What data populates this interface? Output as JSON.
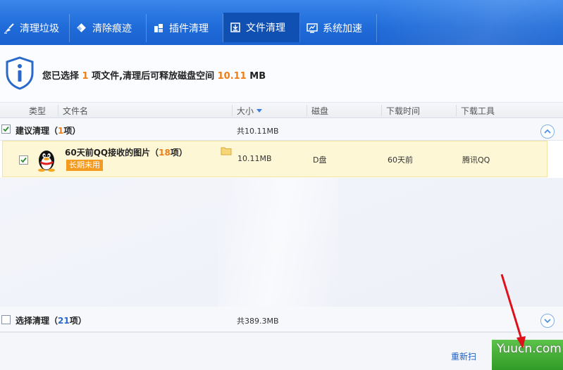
{
  "tabs": [
    {
      "label": "清理垃圾",
      "icon": "broom-icon"
    },
    {
      "label": "清除痕迹",
      "icon": "eraser-icon"
    },
    {
      "label": "插件清理",
      "icon": "plugin-icon"
    },
    {
      "label": "文件清理",
      "icon": "download-box-icon",
      "active": true
    },
    {
      "label": "系统加速",
      "icon": "monitor-icon"
    }
  ],
  "summary": {
    "prefix": "您已选择",
    "count": "1",
    "middle": "项文件,清理后可释放磁盘空间",
    "size": "10.11",
    "unit": "MB"
  },
  "columns": {
    "type": "类型",
    "name": "文件名",
    "size": "大小",
    "disk": "磁盘",
    "time": "下载时间",
    "tool": "下载工具"
  },
  "groups": {
    "recommended": {
      "label": "建议清理（",
      "count": "1",
      "suffix": "项）",
      "total": "共10.11MB",
      "checked": true
    },
    "optional": {
      "label": "选择清理（",
      "count": "21",
      "suffix": "项）",
      "total": "共389.3MB",
      "checked": false
    }
  },
  "file": {
    "name": "60天前QQ接收的图片（",
    "count": "18",
    "suffix": "项）",
    "badge": "长期未用",
    "size": "10.11MB",
    "disk": "D盘",
    "time": "60天前",
    "tool": "腾讯QQ",
    "checked": true
  },
  "bottom": {
    "rescan": "重新扫",
    "watermark": "Yuucn.com"
  },
  "colors": {
    "accent": "#1f6bd9",
    "highlight": "#ef7d15",
    "row_bg": "#fdf7d6",
    "go_button": "#3aa52f"
  }
}
